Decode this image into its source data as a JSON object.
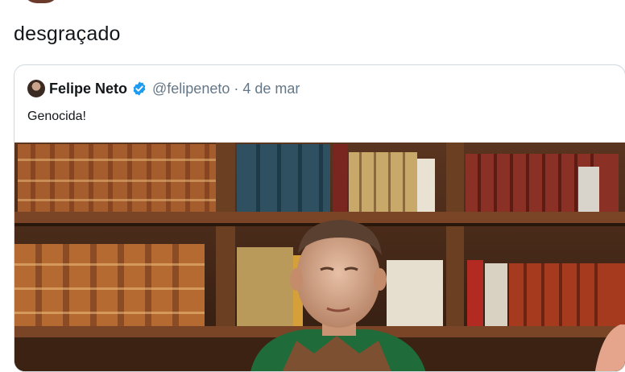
{
  "tweet": {
    "text": "desgraçado"
  },
  "quoted_tweet": {
    "author_name": "Felipe Neto",
    "handle": "@felipeneto",
    "separator": "·",
    "date": "4 de mar",
    "text": "Genocida!",
    "verified": true
  },
  "colors": {
    "text_primary": "#14171a",
    "text_secondary": "#657786",
    "verified_badge": "#1d9bf0",
    "card_border": "#cfd9de"
  },
  "icons": {
    "verified": "verified-badge-icon"
  }
}
